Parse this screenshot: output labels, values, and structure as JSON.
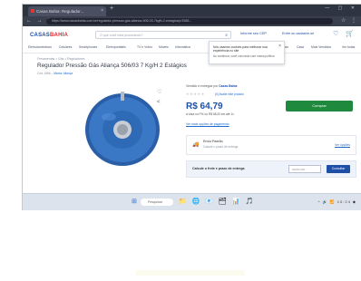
{
  "browser": {
    "tab_title": "Casas Bahia: Regulador...",
    "url": "https://www.casasbahia.com.br/regulador-pressao-gas-alianca-506-03-7kgfh-2-estagios/p/1586...",
    "nav_icons": "← → ↻",
    "toolbar_icons": "☆ ⋮",
    "window_controls": "— ▢ ✕",
    "new_tab": "+"
  },
  "header": {
    "logo_part1": "CASAS",
    "logo_part2": "BAHIA",
    "search_placeholder": "O que você está procurando?",
    "cep_label": "Informe seu CEP",
    "account_label": "Entre ou cadastre-se",
    "icons": "♡ 🛒",
    "categories": [
      "Eletrodomésticos",
      "Celulares",
      "Smartphones",
      "Eletroportáteis",
      "TV e Vídeo",
      "Móveis",
      "Informática",
      "Ofertas",
      "Mercado",
      "Casa",
      "Mais Vendidos",
      "Ver todas"
    ]
  },
  "tooltip": {
    "line1": "Nós usamos cookies para melhorar sua experiência no site",
    "line2": "Ao continuar, você concorda com nossa política",
    "close": "×"
  },
  "product": {
    "breadcrumb": "Ferramentas > Gás > Reguladores",
    "title": "Regulador Pressão Gás Aliança 506/03 7 Kg/H 2 Estágios",
    "code_label": "Cód. 1586... ",
    "brand_link": "Marca: Aliança",
    "side_icons": [
      "♡",
      "<"
    ],
    "seller_prefix": "Vendido e entregue por",
    "seller_name": "Casas Bahia",
    "stars": "★★★★★",
    "rating_text": "(0) Avalie este produto",
    "price": "R$ 64,79",
    "pix_text": "à vista no PIX ou R$ 68,20 em até 1x",
    "installments_link": "Ver mais opções de pagamento",
    "buy_button": "Comprar",
    "shipping_icon": "🚚",
    "shipping_title": "Envio Padrão",
    "shipping_sub": "Calcule o prazo de entrega",
    "shipping_link": "Ver opções",
    "cep_label": "Calcule o frete e prazo de entrega",
    "cep_placeholder": "00000-000",
    "cep_button": "Consultar"
  },
  "taskbar": {
    "start_icon": "⊞",
    "search_label": "Pesquisar",
    "app_icons": "📁 🌐 📧 🗂 📊 🎵",
    "tray": "^ 🔊 📶 10:24 ◆"
  }
}
